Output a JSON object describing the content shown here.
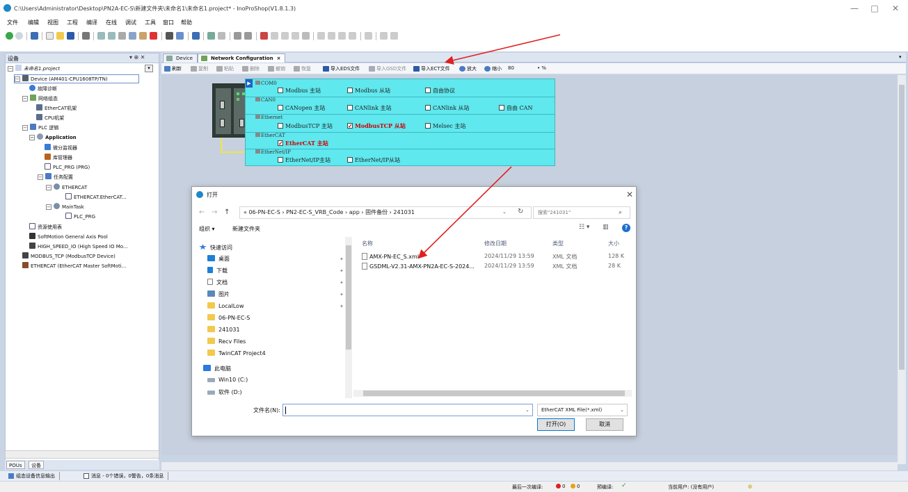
{
  "window": {
    "title": "C:\\Users\\Administrator\\Desktop\\PN2A-EC-S\\新建文件夹\\未命名1\\未命名1.project* - InoProShop(V1.8.1.3)",
    "minimize": "—",
    "maximize": "□",
    "close": "✕"
  },
  "menu": [
    "文件",
    "编辑",
    "视图",
    "工程",
    "编译",
    "在线",
    "调试",
    "工具",
    "窗口",
    "帮助"
  ],
  "device_pane": {
    "title": "设备",
    "controls": "▾ ⊕ ✕",
    "tree": {
      "root": "未命名1.project",
      "device": "Device (AM401-CPU1608TP/TN)",
      "diag": "故障诊断",
      "net_config": "网络组态",
      "ethercat_rack": "EtherCAT机架",
      "cpu_rack": "CPU机架",
      "plc_logic": "PLC 逻辑",
      "application": "Application",
      "micro_monitor": "微分监视器",
      "library_manager": "库管理器",
      "plc_prg": "PLC_PRG (PRG)",
      "task_config": "任务配置",
      "ethercat_task": "ETHERCAT",
      "ethercat_call": "ETHERCAT.EtherCAT...",
      "main_task": "MainTask",
      "plc_prg_call": "PLC_PRG",
      "resource_usage": "资源使用表",
      "softmotion_pool": "SoftMotion General Axis Pool",
      "high_speed_io": "HIGH_SPEED_IO (High Speed IO Mo...",
      "modbus_tcp": "MODBUS_TCP (ModbusTCP Device)",
      "ethercat_master": "ETHERCAT (EtherCAT Master SoftMoti..."
    },
    "bottom_tabs": [
      "POUs",
      "设备"
    ]
  },
  "doc_tabs": [
    {
      "label": "Device"
    },
    {
      "label": "Network Configuration"
    }
  ],
  "net_toolbar": {
    "refresh": "刷新",
    "copy": "复制",
    "paste": "粘贴",
    "delete": "删除",
    "undo": "撤销",
    "redo": "恢复",
    "import_eds": "导入EDS文件",
    "import_gsd": "导入GSD文件",
    "import_ect": "导入ECT文件",
    "zoom_in": "放大",
    "zoom_out": "缩小",
    "zoom_value": "80",
    "zoom_unit": "• %"
  },
  "protocols": {
    "com0": {
      "title": "COM0",
      "opts": [
        "Modbus 主站",
        "Modbus 从站",
        "自由协议"
      ]
    },
    "can0": {
      "title": "CAN0",
      "opts": [
        "CANopen 主站",
        "CANlink 主站",
        "CANlink 从站",
        "自由 CAN"
      ]
    },
    "ethernet": {
      "title": "Ethernet",
      "opts": [
        "ModbusTCP 主站",
        "ModbusTCP 从站",
        "Melsec 主站"
      ]
    },
    "ethercat": {
      "title": "EtherCAT",
      "opts": [
        "EtherCAT 主站"
      ]
    },
    "ethernetip": {
      "title": "EtherNet/IP",
      "opts": [
        "EtherNet/IP主站",
        "EtherNet/IP从站"
      ]
    }
  },
  "dialog": {
    "title": "打开",
    "close": "✕",
    "address": "« 06-PN-EC-S › PN2-EC-S_VRB_Code › app › 固件备份 › 241031",
    "search_placeholder": "搜索\"241031\"",
    "organize": "组织 ▾",
    "new_folder": "新建文件夹",
    "nav": {
      "quick_access": "快速访问",
      "desktop": "桌面",
      "downloads": "下载",
      "documents": "文档",
      "pictures": "图片",
      "locallow": "LocalLow",
      "folder_06": "06-PN-EC-S",
      "folder_241031": "241031",
      "recv_files": "Recv Files",
      "twincat": "TwinCAT Project4",
      "this_pc": "此电脑",
      "win10": "Win10 (C:)",
      "software": "软件 (D:)"
    },
    "columns": {
      "name": "名称",
      "date": "修改日期",
      "type": "类型",
      "size": "大小"
    },
    "files": [
      {
        "name": "AMX-PN-EC_S.xml",
        "date": "2024/11/29 13:59",
        "type": "XML 文档",
        "size": "128 K"
      },
      {
        "name": "GSDML-V2.31-AMX-PN2A-EC-S-2024...",
        "date": "2024/11/29 13:59",
        "type": "XML 文档",
        "size": "28 K"
      }
    ],
    "filename_label": "文件名(N):",
    "filename_value": "",
    "filetype": "EtherCAT  XML  File(*.xml)",
    "open_button": "打开(O)",
    "cancel_button": "取消"
  },
  "status": {
    "tab_output": "组态设备信息输出",
    "tab_messages": "消息 - 0个错误，0警告，0条消息",
    "last_build": "最后一次编译:",
    "err_count": "0",
    "warn_count": "0",
    "precompile": "预编译:",
    "precompile_ok": "✓",
    "current_user": "当前用户: (没有用户)"
  },
  "colors": {
    "protocol_panel": "#5fe8ee",
    "annotation_arrow": "#e02020",
    "workspace": "#c7d0de"
  }
}
